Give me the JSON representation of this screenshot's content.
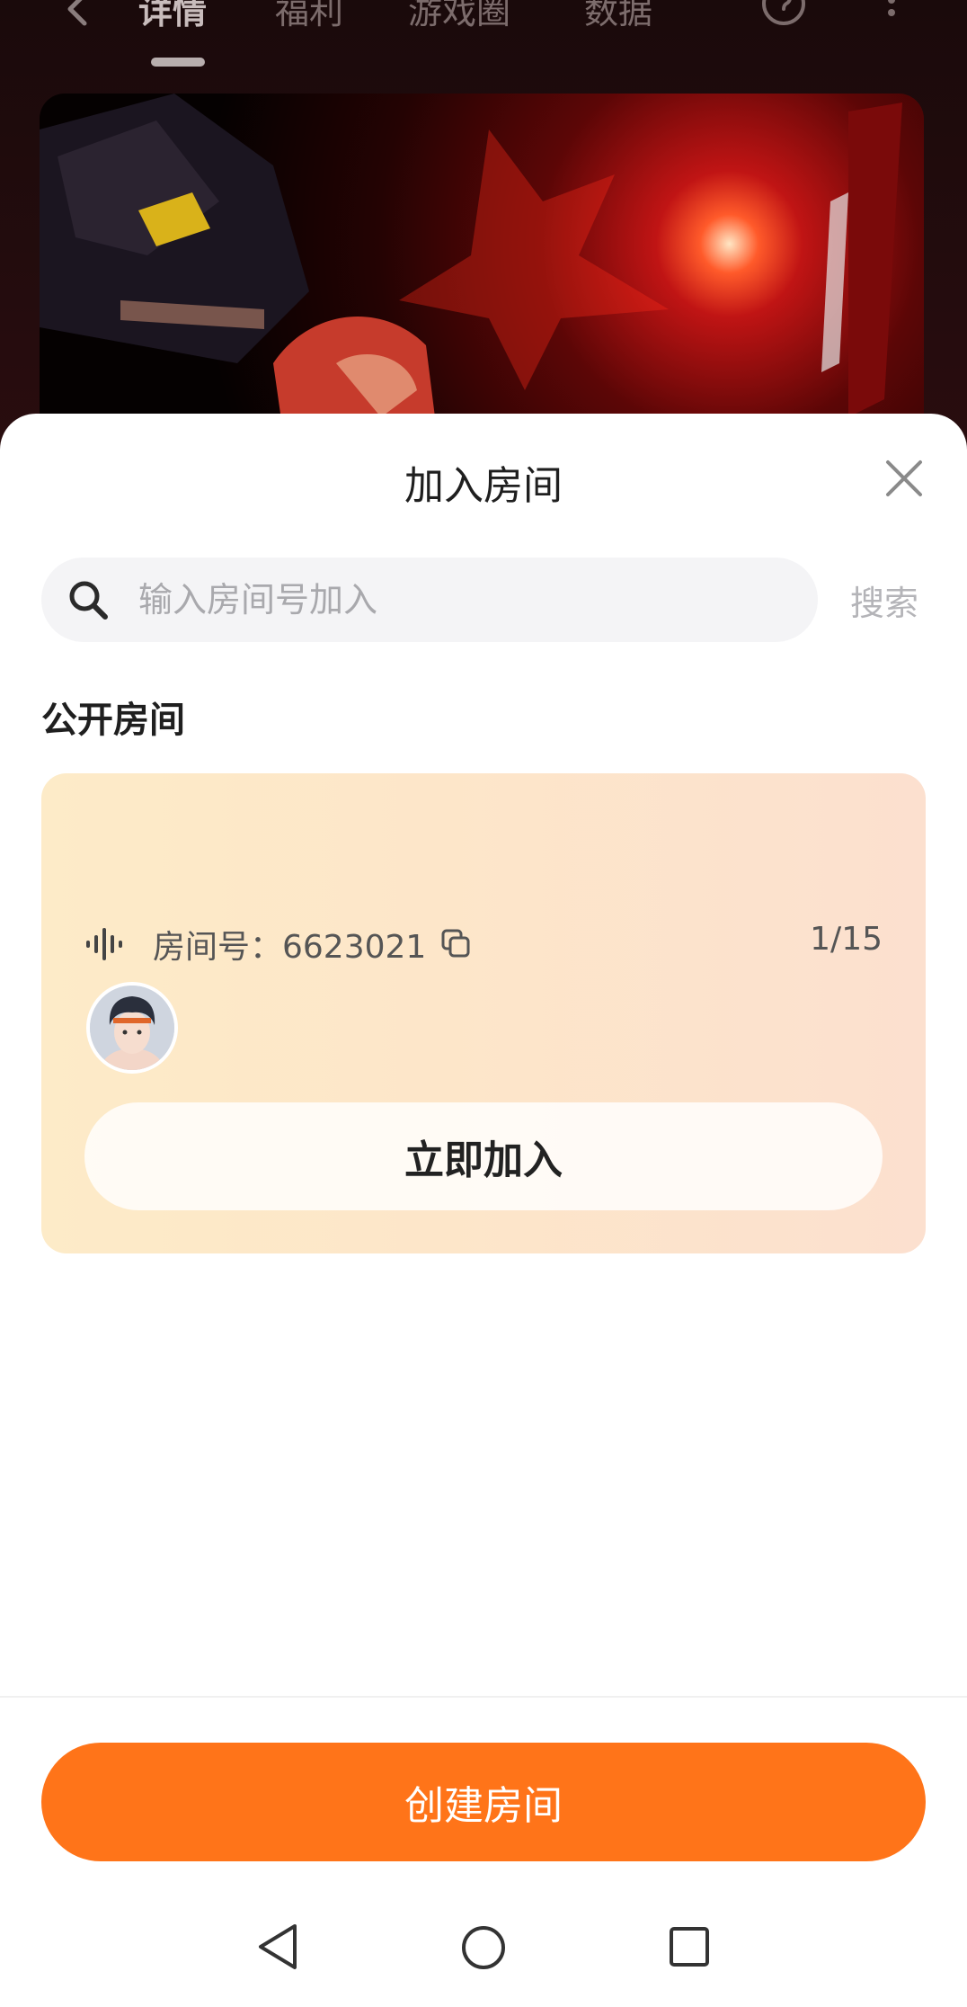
{
  "background": {
    "tabs": [
      "详情",
      "福利",
      "游戏圈",
      "数据"
    ],
    "active_tab_index": 0
  },
  "sheet": {
    "title": "加入房间",
    "search": {
      "placeholder": "输入房间号加入",
      "value": "",
      "button_label": "搜索"
    },
    "section_title": "公开房间",
    "rooms": [
      {
        "room_label": "房间号：6623021",
        "count": "1/15",
        "join_label": "立即加入"
      }
    ],
    "create_label": "创建房间"
  },
  "colors": {
    "accent": "#ff7419",
    "card_gradient_start": "#fdebc8",
    "card_gradient_end": "#fce0cf"
  },
  "icons": [
    "back-icon",
    "help-icon",
    "more-icon",
    "close-icon",
    "search-icon",
    "voice-wave-icon",
    "copy-icon",
    "nav-back-icon",
    "nav-home-icon",
    "nav-recent-icon"
  ]
}
